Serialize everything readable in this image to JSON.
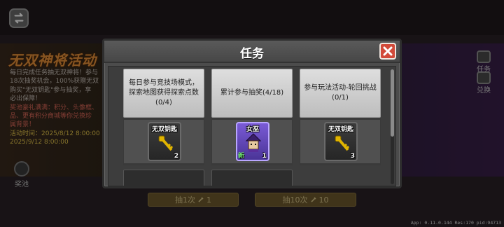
{
  "event": {
    "title": "无双神将活动",
    "desc_lines": [
      {
        "text": "每日完成任务抽无双神将！参与",
        "cls": ""
      },
      {
        "text": "18次抽奖机会，100%获赠无双",
        "cls": ""
      },
      {
        "text": "购买\"无双钥匙\"参与抽奖，享",
        "cls": ""
      },
      {
        "text": "必出保障！",
        "cls": ""
      },
      {
        "text": "奖池豪礼满满：积分、头像框、",
        "cls": "rd"
      },
      {
        "text": "品、更有积分商城等你兑换珍",
        "cls": "rd"
      },
      {
        "text": "属背景！",
        "cls": "rd"
      },
      {
        "text": "活动时间：2025/8/12 8:00:00",
        "cls": "hl"
      },
      {
        "text": "2025/9/12 8:00:00",
        "cls": "hl"
      }
    ],
    "pool_label": "奖池",
    "side_task_label": "任务",
    "side_exchange_label": "兑换",
    "draw1_label": "抽1次",
    "draw1_cost": "1",
    "draw10_label": "抽10次",
    "draw10_cost": "10"
  },
  "modal": {
    "title": "任务",
    "tasks": [
      {
        "desc": "每日参与竞技场模式，探索地图获得探索点数(0/4)",
        "reward_name": "无双钥匙",
        "reward_count": "2",
        "reward_type": "key"
      },
      {
        "desc": "累计参与抽奖(4/18)",
        "reward_name": "女巫",
        "reward_count": "1",
        "reward_new": "新",
        "reward_type": "hero"
      },
      {
        "desc": "参与玩法活动-轮回挑战(0/1)",
        "reward_name": "无双钥匙",
        "reward_count": "3",
        "reward_type": "key"
      }
    ]
  },
  "version": "App: 0.11.0.144 Res:170 pid:94713",
  "colors": {
    "accent_orange": "#e8923a",
    "close_red": "#d24a3a",
    "gold": "#d8c58a",
    "key_gold": "#e0b400"
  }
}
